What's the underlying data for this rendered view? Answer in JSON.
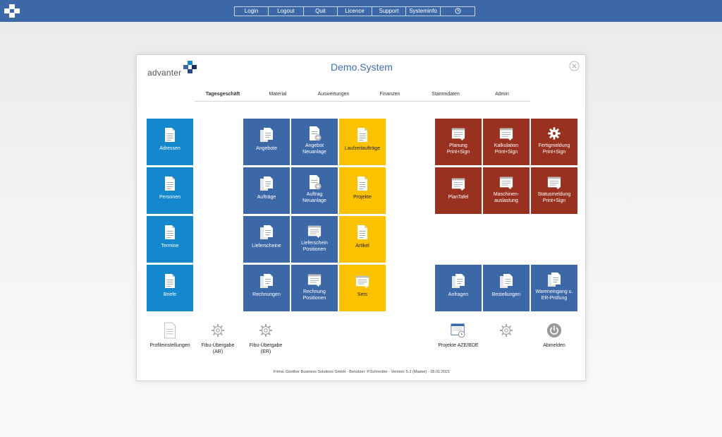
{
  "topbar": {
    "menu": [
      {
        "label": "Login"
      },
      {
        "label": "Logout"
      },
      {
        "label": "Quit"
      },
      {
        "label": "Licence"
      },
      {
        "label": "Support"
      },
      {
        "label": "Systeminfo"
      }
    ],
    "clock_icon": "clock-icon"
  },
  "panel": {
    "brand": "advanter",
    "title": "Demo.System"
  },
  "tabs": [
    {
      "label": "Tagesgeschäft",
      "active": true
    },
    {
      "label": "Material"
    },
    {
      "label": "Auswertungen"
    },
    {
      "label": "Finanzen"
    },
    {
      "label": "Stammdaten"
    },
    {
      "label": "Admin"
    }
  ],
  "tiles": {
    "adressen": "Adressen",
    "personen": "Personen",
    "termine": "Termine",
    "briefe": "Briefe",
    "angebote": "Angebote",
    "angebot_neu": "Angebot\nNeuanlage",
    "laufzeit": "Laufzeitaufträge",
    "auftraege": "Aufträge",
    "auftrag_neu": "Auftrag\nNeuanlage",
    "projekte": "Projekte",
    "lieferscheine": "Lieferscheine",
    "lieferschein_pos": "Lieferschein\nPositionen",
    "artikel": "Artikel",
    "rechnungen": "Rechnungen",
    "rechnung_pos": "Rechnung\nPositionen",
    "sets": "Sets",
    "planung": "Planung\nPrint+Sign",
    "kalkulation": "Kalkulation\nPrint+Sign",
    "fertig": "Fertigmeldung\nPrint+Sign",
    "plantafel": "PlanTafel",
    "maschinen": "Maschinen-\nauslastung",
    "status": "Statusmeldung\nPrint+Sign",
    "anfragen": "Anfragen",
    "bestellungen": "Bestellungen",
    "wareneingang": "Wareneingang u.\nER-Prüfung"
  },
  "bottom": {
    "profil": "Profileinstellungen",
    "fibu_ar": "Fibu-Übergabe\n(AR)",
    "fibu_er": "Fibu-Übergabe\n(ER)",
    "projekte_aze": "Projekte AZE/BDE",
    "abmelden": "Abmelden"
  },
  "footer": "Firma: Günther Business Solutions GmbH - Benutzer: P.Schneider - Version: 5.2 (Master) - 05.01.2021",
  "colors": {
    "topbar": "#3d68a8",
    "cyan": "#1587cc",
    "blue": "#3d68a8",
    "yellow": "#fcc200",
    "red": "#993121"
  }
}
